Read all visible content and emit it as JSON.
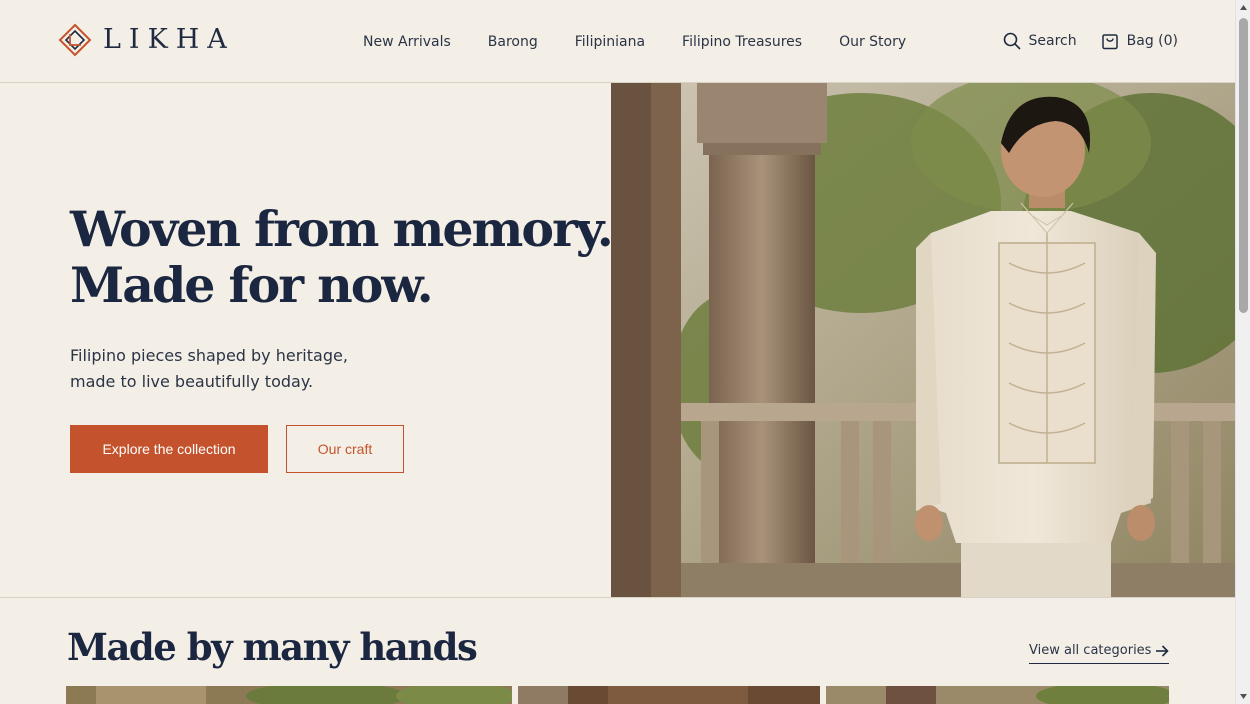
{
  "brand": {
    "name": "LIKHA",
    "accent": "#c4532d",
    "navy": "#1b2640",
    "background": "#f4efe6"
  },
  "nav": {
    "items": [
      {
        "label": "New Arrivals"
      },
      {
        "label": "Barong"
      },
      {
        "label": "Filipiniana"
      },
      {
        "label": "Filipino Treasures"
      },
      {
        "label": "Our Story"
      }
    ]
  },
  "utils": {
    "search_label": "Search",
    "bag_label": "Bag (0)",
    "search_icon": "search-icon",
    "bag_icon": "shopping-bag-icon"
  },
  "hero": {
    "title_line1": "Woven from memory.",
    "title_line2": "Made for now.",
    "subtitle_line1": "Filipino pieces shaped by heritage,",
    "subtitle_line2": "made to live beautifully today.",
    "primary_cta": "Explore the collection",
    "secondary_cta": "Our craft"
  },
  "categories": {
    "title": "Made by many hands",
    "view_all": "View all categories"
  }
}
